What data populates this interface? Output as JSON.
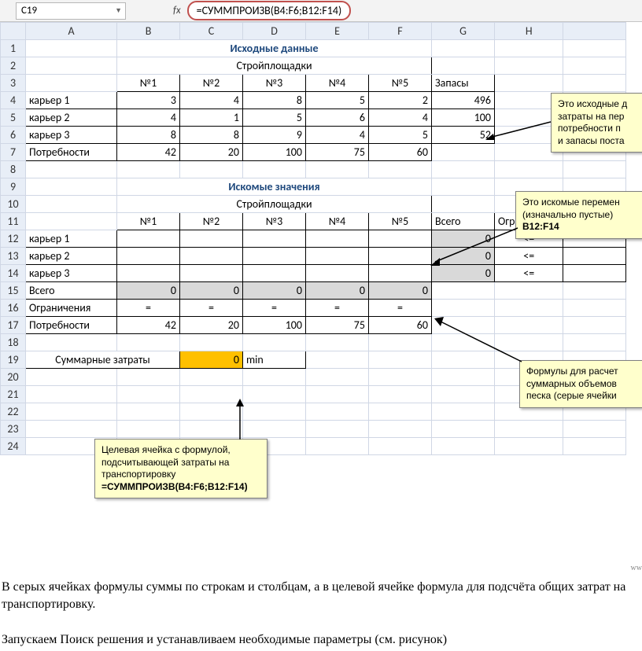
{
  "formula_bar": {
    "cell_ref": "C19",
    "fx": "fx",
    "formula": "=СУММПРОИЗВ(B4:F6;B12:F14)"
  },
  "cols": [
    "A",
    "B",
    "C",
    "D",
    "E",
    "F",
    "G",
    "H"
  ],
  "rows": [
    "1",
    "2",
    "3",
    "4",
    "5",
    "6",
    "7",
    "8",
    "9",
    "10",
    "11",
    "12",
    "13",
    "14",
    "15",
    "16",
    "17",
    "18",
    "19",
    "20",
    "21",
    "22",
    "23",
    "24"
  ],
  "h1": "Исходные данные",
  "h2": "Искомые значения",
  "sub_sites": "Стройплощадки",
  "site_cols": [
    "№1",
    "№2",
    "№3",
    "№4",
    "№5"
  ],
  "supply_label": "Запасы",
  "quarries": [
    "карьер 1",
    "карьер 2",
    "карьер 3"
  ],
  "needs_label": "Потребности",
  "data1": {
    "r1": [
      "3",
      "4",
      "8",
      "5",
      "2",
      "496"
    ],
    "r2": [
      "4",
      "1",
      "5",
      "6",
      "4",
      "100"
    ],
    "r3": [
      "8",
      "8",
      "9",
      "4",
      "5",
      "52"
    ],
    "needs": [
      "42",
      "20",
      "100",
      "75",
      "60"
    ]
  },
  "total_label": "Всего",
  "constraints_label": "Ограничения",
  "data2": {
    "g12": "0",
    "g13": "0",
    "g14": "0",
    "h12": "<=",
    "h13": "<=",
    "h14": "<=",
    "tot_row": [
      "0",
      "0",
      "0",
      "0",
      "0"
    ],
    "cons": [
      "=",
      "=",
      "=",
      "=",
      "="
    ],
    "needs": [
      "42",
      "20",
      "100",
      "75",
      "60"
    ]
  },
  "summary_label": "Суммарные затраты",
  "summary_value": "0",
  "summary_min": "min",
  "callouts": {
    "c1_l1": "Это исходные д",
    "c1_l2": "затраты на пер",
    "c1_l3": "потребности п",
    "c1_l4": "и запасы поста",
    "c2_l1": "Это искомые перемен",
    "c2_l2": "(изначально пустые)",
    "c2_l3": "B12:F14",
    "c3_l1": "Формулы для расчет",
    "c3_l2": "суммарных объемов",
    "c3_l3": "песка (серые ячейки",
    "c4_l1": "Целевая ячейка с формулой,",
    "c4_l2": "подсчитывающей затраты на",
    "c4_l3": "транспортировку",
    "c4_l4": "=СУММПРОИЗВ(B4:F6;B12:F14)"
  },
  "footer": {
    "p1": "В серых ячейках формулы суммы по строкам и столбцам, а в целевой ячейке формула для подсчёта общих затрат на транспортировку.",
    "p2": "Запускаем Поиск решения и устанавливаем необходимые параметры (см. рисунок)"
  }
}
